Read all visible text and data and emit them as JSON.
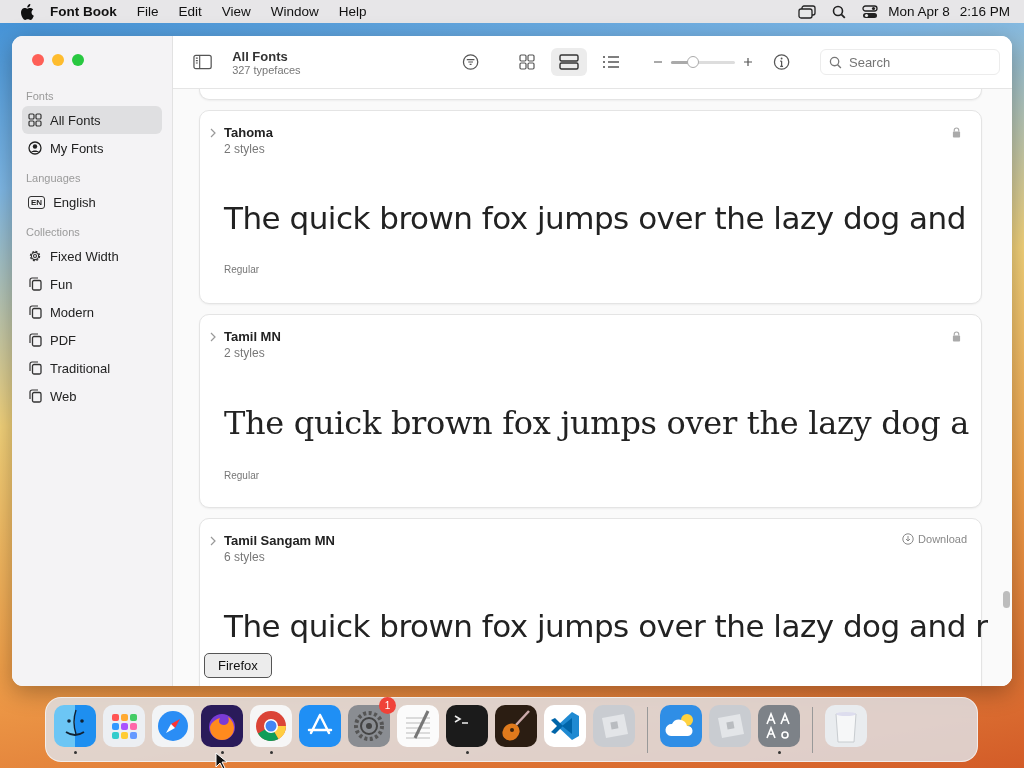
{
  "menu_bar": {
    "app_name": "Font Book",
    "menus": [
      "File",
      "Edit",
      "View",
      "Window",
      "Help"
    ],
    "date": "Mon Apr 8",
    "time": "2:16 PM"
  },
  "sidebar": {
    "sections": [
      {
        "title": "Fonts",
        "items": [
          {
            "label": "All Fonts",
            "kind": "grid",
            "selected": true
          },
          {
            "label": "My Fonts",
            "kind": "person",
            "selected": false
          }
        ]
      },
      {
        "title": "Languages",
        "items": [
          {
            "label": "English",
            "kind": "badge",
            "badge": "EN",
            "selected": false
          }
        ]
      },
      {
        "title": "Collections",
        "items": [
          {
            "label": "Fixed Width",
            "kind": "gear",
            "selected": false
          },
          {
            "label": "Fun",
            "kind": "stack",
            "selected": false
          },
          {
            "label": "Modern",
            "kind": "stack",
            "selected": false
          },
          {
            "label": "PDF",
            "kind": "stack",
            "selected": false
          },
          {
            "label": "Traditional",
            "kind": "stack",
            "selected": false
          },
          {
            "label": "Web",
            "kind": "stack",
            "selected": false
          }
        ]
      }
    ]
  },
  "toolbar": {
    "title": "All Fonts",
    "subtitle": "327 typefaces",
    "views": [
      {
        "kind": "grid",
        "selected": false
      },
      {
        "kind": "rows",
        "selected": true
      },
      {
        "kind": "list",
        "selected": false
      }
    ],
    "size_slider": {
      "level": 0.35
    },
    "search": {
      "placeholder": "Search"
    }
  },
  "fonts": [
    {
      "name": "Tahoma",
      "styles": "2 styles",
      "kind": "locked",
      "sample": {
        "text": "The quick brown fox jumps over the lazy dog and",
        "kind": "sans"
      },
      "style_label": "Regular"
    },
    {
      "name": "Tamil MN",
      "styles": "2 styles",
      "kind": "locked",
      "sample": {
        "text": "The quick brown fox jumps over the lazy dog a",
        "kind": "serif"
      },
      "style_label": "Regular"
    },
    {
      "name": "Tamil Sangam MN",
      "styles": "6 styles",
      "kind": "download",
      "status_label": "Download",
      "sample": {
        "text": "The quick brown fox jumps over the lazy dog and r",
        "kind": "sans"
      }
    }
  ],
  "tooltip": "Firefox",
  "dock": [
    {
      "kind": "face",
      "running": true
    },
    {
      "kind": "apps",
      "running": false
    },
    {
      "kind": "compass",
      "running": false
    },
    {
      "kind": "fox",
      "running": true
    },
    {
      "kind": "ring",
      "running": true
    },
    {
      "kind": "store",
      "running": false
    },
    {
      "kind": "gear",
      "running": false,
      "badge": "1"
    },
    {
      "kind": "notepad",
      "running": false
    },
    {
      "kind": "terminal",
      "running": true
    },
    {
      "kind": "guitar",
      "running": false
    },
    {
      "kind": "code",
      "running": false
    },
    {
      "kind": "cube",
      "running": false
    },
    {
      "kind": "separator"
    },
    {
      "kind": "cloud",
      "running": false
    },
    {
      "kind": "cube",
      "running": false
    },
    {
      "kind": "letters",
      "running": true
    },
    {
      "kind": "separator"
    },
    {
      "kind": "trash",
      "running": false
    }
  ]
}
